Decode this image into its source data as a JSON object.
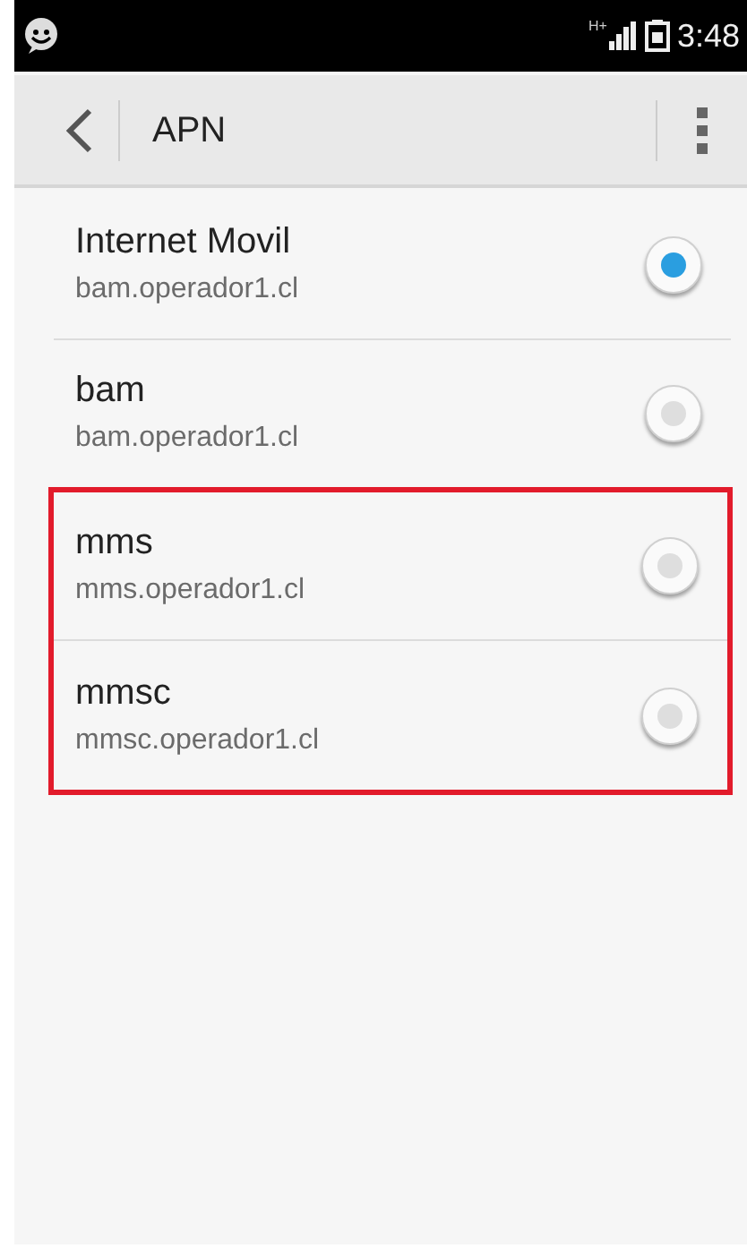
{
  "status_bar": {
    "time": "3:48",
    "network": "H+"
  },
  "toolbar": {
    "title": "APN"
  },
  "apns": [
    {
      "name": "Internet Movil",
      "address": "bam.operador1.cl",
      "selected": true,
      "highlighted": false
    },
    {
      "name": "bam",
      "address": "bam.operador1.cl",
      "selected": false,
      "highlighted": false
    },
    {
      "name": "mms",
      "address": "mms.operador1.cl",
      "selected": false,
      "highlighted": true
    },
    {
      "name": "mmsc",
      "address": "mmsc.operador1.cl",
      "selected": false,
      "highlighted": true
    }
  ]
}
